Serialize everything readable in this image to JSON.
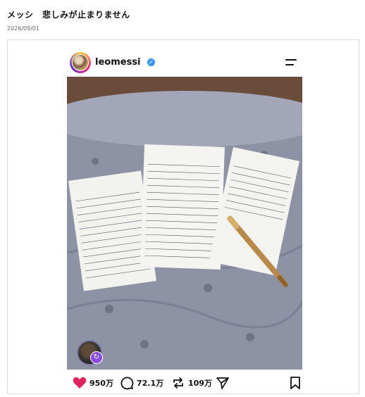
{
  "article": {
    "title": "メッシ　悲しみが止まりません",
    "date": "2026/09/01"
  },
  "post": {
    "username": "leomessi",
    "verified_mark": "✓",
    "icons": {
      "menu": "hamburger-menu-icon",
      "like": "heart-icon",
      "comment": "comment-icon",
      "repost": "repost-icon",
      "share": "send-icon",
      "save": "bookmark-icon"
    },
    "like_count": "950万",
    "comment_count": "72.1万",
    "repost_count": "109万",
    "badge_glyph": "↻",
    "colors": {
      "like": "#e0245e",
      "verified": "#3897f0",
      "badge": "#8a4de0"
    }
  }
}
